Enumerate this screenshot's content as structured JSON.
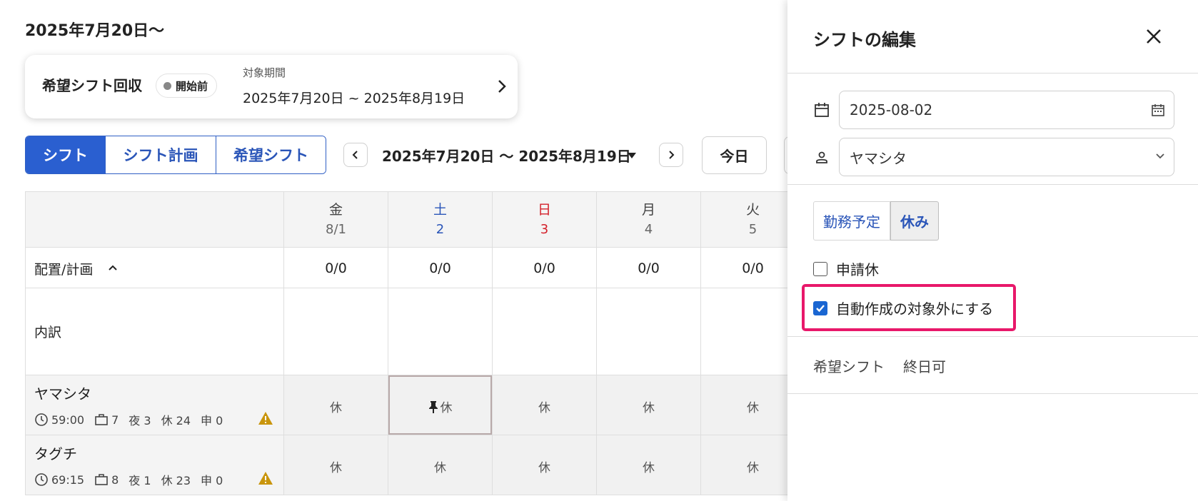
{
  "page": {
    "title": "2025年7月20日〜"
  },
  "collect_card": {
    "title": "希望シフト回収",
    "status": "開始前",
    "period_label": "対象期間",
    "period_value": "2025年7月20日 ~ 2025年8月19日"
  },
  "toolbar": {
    "tabs": [
      {
        "label": "シフト",
        "active": true
      },
      {
        "label": "シフト計画",
        "active": false
      },
      {
        "label": "希望シフト",
        "active": false
      }
    ],
    "range": "2025年7月20日 〜 2025年8月19日",
    "today": "今日"
  },
  "grid": {
    "days": [
      {
        "dow": "金",
        "date": "8/1"
      },
      {
        "dow": "土",
        "date": "2"
      },
      {
        "dow": "日",
        "date": "3"
      },
      {
        "dow": "月",
        "date": "4"
      },
      {
        "dow": "火",
        "date": "5"
      }
    ],
    "plan_label": "配置/計画",
    "plan_values": [
      "0/0",
      "0/0",
      "0/0",
      "0/0",
      "0/0"
    ],
    "detail_label": "内訳",
    "employees": [
      {
        "name": "ヤマシタ",
        "hours": "59:00",
        "work": "7",
        "night": "夜 3",
        "off": "休 24",
        "request": "申 0",
        "cells": [
          "休",
          "休",
          "休",
          "休",
          "休"
        ]
      },
      {
        "name": "タグチ",
        "hours": "69:15",
        "work": "8",
        "night": "夜 1",
        "off": "休 23",
        "request": "申 0",
        "cells": [
          "休",
          "休",
          "休",
          "休",
          "休"
        ]
      }
    ]
  },
  "panel": {
    "title": "シフトの編集",
    "date_value": "2025-08-02",
    "employee_value": "ヤマシタ",
    "type_work": "勤務予定",
    "type_off": "休み",
    "checkbox_request": "申請休",
    "checkbox_request_checked": false,
    "checkbox_exclude": "自動作成の対象外にする",
    "checkbox_exclude_checked": true,
    "pref_label": "希望シフト",
    "pref_value": "終日可"
  },
  "colors": {
    "accent": "#2a5fd0",
    "saturday": "#2a55b8",
    "sunday": "#d4202a",
    "highlight": "#e8186a",
    "warning": "#c9950c"
  }
}
